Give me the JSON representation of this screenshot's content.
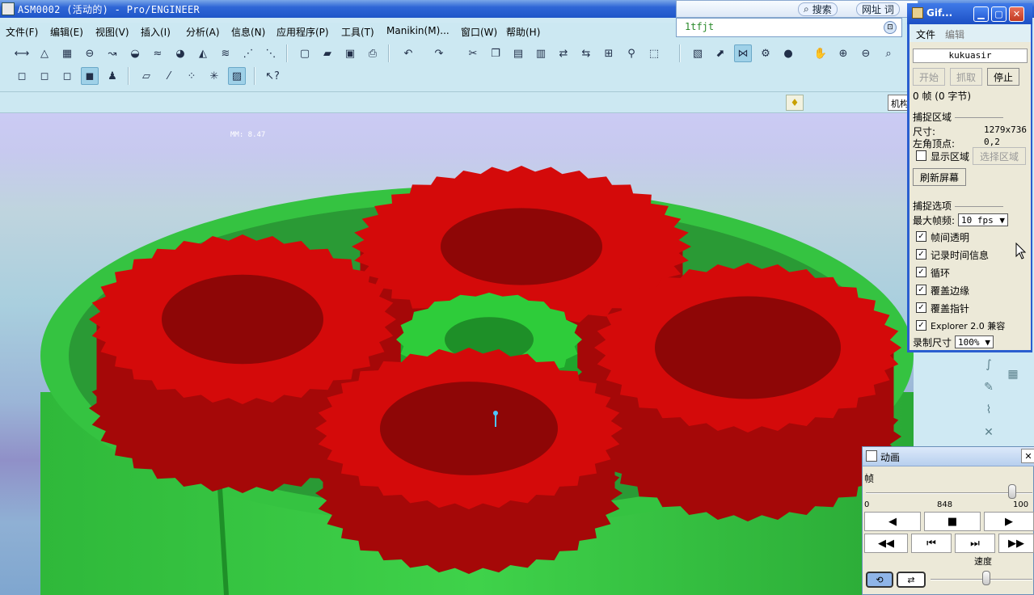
{
  "window": {
    "title": "ASM0002 (活动的) - Pro/ENGINEER"
  },
  "menu": [
    "文件(F)",
    "编辑(E)",
    "视图(V)",
    "插入(I)",
    "分析(A)",
    "信息(N)",
    "应用程序(P)",
    "工具(T)",
    "Manikin(M)...",
    "窗口(W)",
    "帮助(H)"
  ],
  "strip": {
    "mech_label": "机构"
  },
  "viewport": {
    "readout": "MM: 8.47"
  },
  "search_bar": {
    "search_label": "搜索",
    "url_label": "网址 词",
    "url_value": "1tfjt"
  },
  "gif_window": {
    "title": "Gif...",
    "menu_file": "文件",
    "menu_edit": "编辑",
    "username": "kukuasir",
    "btn_start": "开始",
    "btn_capture": "抓取",
    "btn_stop": "停止",
    "frame_info": "0 帧 (0 字节)",
    "section_capture": "捕捉区域",
    "size_label": "尺寸:",
    "size_value": "1279x736",
    "corner_label": "左角顶点:",
    "corner_value": "0,2",
    "show_region": "显示区域",
    "select_region": "选择区域",
    "refresh": "刷新屏幕",
    "section_options": "捕捉选项",
    "max_fps_label": "最大帧频:",
    "max_fps_value": "10 fps",
    "opt_transparent": "帧间透明",
    "opt_timeinfo": "记录时间信息",
    "opt_loop": "循环",
    "opt_edges": "覆盖边缘",
    "opt_cursor": "覆盖指针",
    "opt_explorer": "Explorer 2.0 兼容",
    "rec_size_label": "录制尺寸",
    "rec_size_value": "100%"
  },
  "anim_window": {
    "title": "动画",
    "frames_label": "帧",
    "min": "0",
    "current": "848",
    "max": "100",
    "frame_position": 0.9,
    "speed_label": "速度",
    "speed_position": 0.55
  },
  "colors": {
    "gear_red": "#d40a0a",
    "gear_green": "#2ecc3a",
    "titlebar": "#2f66d6",
    "toolbar_bg": "#cce8f2"
  }
}
